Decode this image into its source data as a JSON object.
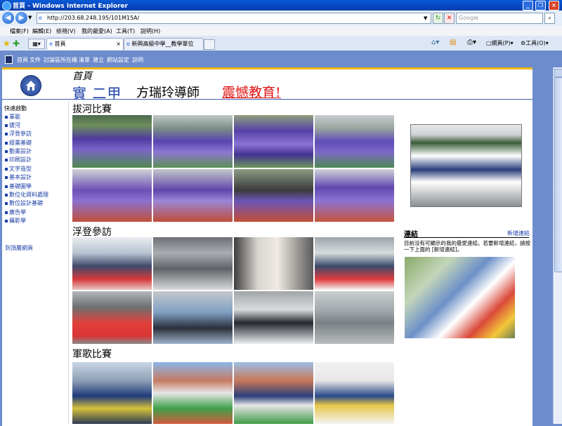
{
  "window": {
    "title": "首頁 - Windows Internet Explorer"
  },
  "address": {
    "url": "http://203.68.248.195/101M15A/",
    "search_placeholder": "Google"
  },
  "menu": [
    "檔案(F)",
    "編輯(E)",
    "檢視(V)",
    "我的最愛(A)",
    "工具(T)",
    "說明(H)"
  ],
  "tabs": [
    {
      "label": "首頁"
    },
    {
      "label": "新興高級中學__教學單位"
    }
  ],
  "command_bar": {
    "page_label": "網頁(P)",
    "tools_label": "工具(O)"
  },
  "site_nav": [
    "首頁",
    "文件",
    "討論區所在櫃",
    "清單",
    "建立",
    "網站設定",
    "說明"
  ],
  "header": {
    "home": "首頁",
    "class_name": "實 二甲",
    "teacher": "方瑞玲導師",
    "motto": "震憾教育!"
  },
  "sidebar": {
    "label": "快速啟動",
    "items": [
      "軍歌",
      "拔河",
      "浮登參訪",
      "繪畫基礎",
      "動畫設計",
      "印刷設計",
      "文字造型",
      "基本設計",
      "基礎圖學",
      "數位化資料處理",
      "數位設計基礎",
      "廣告學",
      "攝影學"
    ],
    "back_link": "到頂層網頁"
  },
  "sections": [
    {
      "title": "拔河比賽"
    },
    {
      "title": "浮登參訪"
    },
    {
      "title": "軍歌比賽"
    }
  ],
  "links": {
    "title": "連結",
    "new_link": "新增連結",
    "description": "目前沒有可顯示的我的最愛連結。若要新增連結，請按一下上面的 [新增連結]。"
  }
}
